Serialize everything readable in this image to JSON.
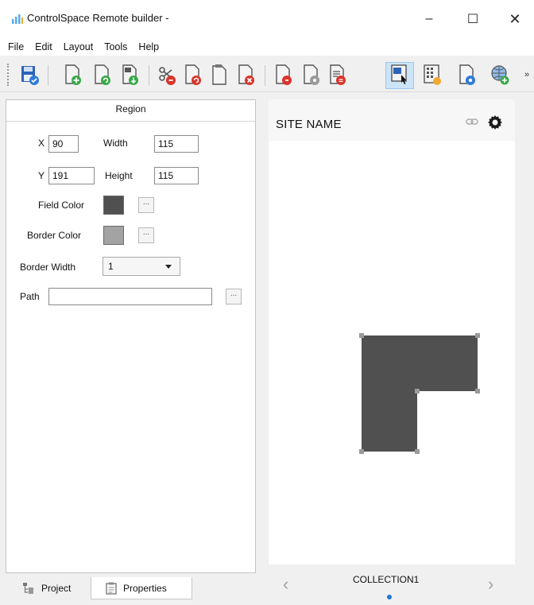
{
  "window": {
    "title": "ControlSpace Remote builder -",
    "minimize": "–",
    "maximize": "☐",
    "close": "✕"
  },
  "menu": [
    "File",
    "Edit",
    "Layout",
    "Tools",
    "Help"
  ],
  "toolbar": {
    "buttons": [
      "save-icon",
      "new-page-icon",
      "refresh-page-icon",
      "export-page-icon",
      "cut-icon",
      "page-copy-icon",
      "page-icon",
      "delete-page-icon",
      "page-red-icon",
      "page-gray-icon",
      "page-list-icon",
      "region-tool-icon",
      "keypad-icon",
      "page-blue-icon",
      "globe-icon"
    ],
    "overflow": "»",
    "accent": "#3a7bd5"
  },
  "properties": {
    "header": "Region",
    "x_label": "X",
    "x_value": "90",
    "width_label": "Width",
    "width_value": "115",
    "y_label": "Y",
    "y_value": "191",
    "height_label": "Height",
    "height_value": "115",
    "field_color_label": "Field Color",
    "field_color": "#505050",
    "border_color_label": "Border Color",
    "border_color": "#a3a3a3",
    "browse_label": "...",
    "border_width_label": "Border Width",
    "border_width_value": "1",
    "path_label": "Path",
    "path_value": ""
  },
  "tabs": {
    "project": "Project",
    "properties": "Properties"
  },
  "preview": {
    "site_name": "SITE NAME",
    "collection": "COLLECTION1",
    "prev": "‹",
    "next": "›",
    "shape_color": "#505050",
    "handle_color": "#9a9a9a",
    "dot_color": "#1a7ad6"
  }
}
